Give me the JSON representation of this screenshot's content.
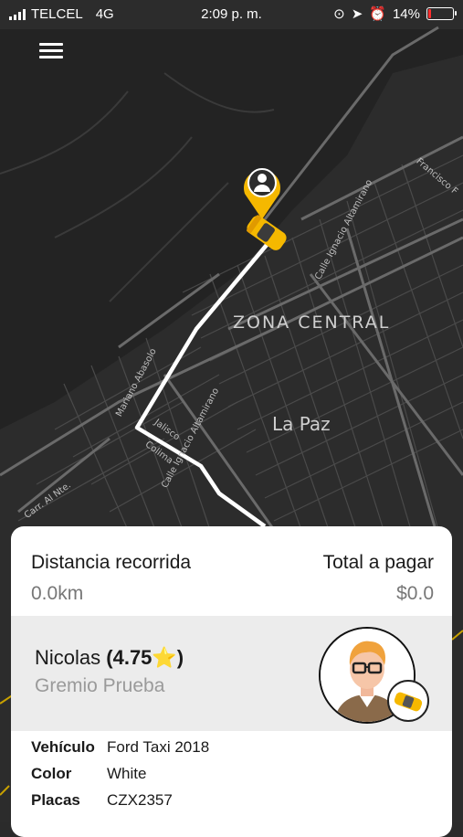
{
  "status_bar": {
    "carrier": "TELCEL",
    "network": "4G",
    "time": "2:09 p. m.",
    "battery": "14%",
    "battery_level": 0.14
  },
  "map": {
    "labels": {
      "zona": "ZONA CENTRAL",
      "lapaz": "La Paz"
    },
    "streets": {
      "francisco": "Francisco F",
      "ignacio_top": "Calle Ignacio Altamirano",
      "mariano": "Mariano Abasolo",
      "jalisco": "Jalisco",
      "colima": "Colima",
      "ignacio_bottom": "Calle Ignacio Altamirano",
      "carr": "Carr. Al Nte."
    }
  },
  "trip": {
    "distance_label": "Distancia recorrida",
    "distance_value": "0.0km",
    "total_label": "Total a pagar",
    "total_value": "$0.0"
  },
  "driver": {
    "name": "Nicolas",
    "rating": "(4.75⭐)",
    "company": "Gremio Prueba"
  },
  "vehicle": {
    "rows": [
      {
        "key": "Vehículo",
        "value": "Ford Taxi 2018"
      },
      {
        "key": "Color",
        "value": "White"
      },
      {
        "key": "Placas",
        "value": "CZX2357"
      }
    ]
  },
  "colors": {
    "accent": "#f5b800",
    "route": "#ffffff",
    "map_bg": "#2b2b2b",
    "battery_low": "#ff2d2d"
  }
}
